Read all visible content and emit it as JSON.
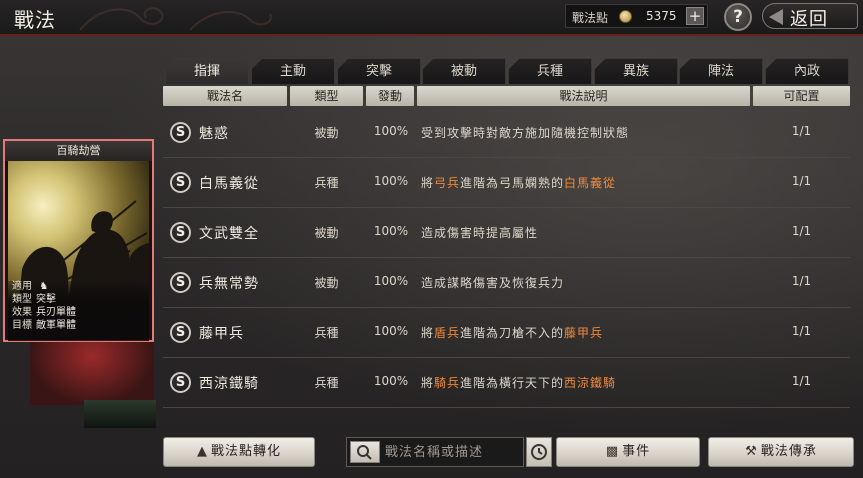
{
  "window": {
    "title": "戰法"
  },
  "header": {
    "points_label": "戰法點",
    "points_value": "5375",
    "plus_icon": "plus-icon",
    "help_label": "?",
    "back_label": "返回"
  },
  "tabs": [
    {
      "label": "指揮",
      "active": true
    },
    {
      "label": "主動"
    },
    {
      "label": "突擊"
    },
    {
      "label": "被動"
    },
    {
      "label": "兵種"
    },
    {
      "label": "異族"
    },
    {
      "label": "陣法"
    },
    {
      "label": "內政"
    }
  ],
  "columns": [
    "戰法名",
    "類型",
    "發動",
    "戰法說明",
    "可配置"
  ],
  "rows": [
    {
      "icon": "S",
      "name": "魅惑",
      "type": "被動",
      "rate": "100%",
      "desc": [
        {
          "t": "受到攻擊時對敵方施加隨機控制狀態"
        }
      ],
      "cfg": "1/1"
    },
    {
      "icon": "S",
      "name": "白馬義從",
      "type": "兵種",
      "rate": "100%",
      "desc": [
        {
          "t": "將"
        },
        {
          "t": "弓兵",
          "hl": true
        },
        {
          "t": "進階為弓馬嫻熟的"
        },
        {
          "t": "白馬義從",
          "hl": true
        }
      ],
      "cfg": "1/1"
    },
    {
      "icon": "S",
      "name": "文武雙全",
      "type": "被動",
      "rate": "100%",
      "desc": [
        {
          "t": "造成傷害時提高屬性"
        }
      ],
      "cfg": "1/1"
    },
    {
      "icon": "S",
      "name": "兵無常勢",
      "type": "被動",
      "rate": "100%",
      "desc": [
        {
          "t": "造成謀略傷害及恢復兵力"
        }
      ],
      "cfg": "1/1"
    },
    {
      "icon": "S",
      "name": "藤甲兵",
      "type": "兵種",
      "rate": "100%",
      "desc": [
        {
          "t": "將"
        },
        {
          "t": "盾兵",
          "hl": true
        },
        {
          "t": "進階為刀槍不入的"
        },
        {
          "t": "藤甲兵",
          "hl": true
        }
      ],
      "cfg": "1/1"
    },
    {
      "icon": "S",
      "name": "西涼鐵騎",
      "type": "兵種",
      "rate": "100%",
      "desc": [
        {
          "t": "將"
        },
        {
          "t": "騎兵",
          "hl": true
        },
        {
          "t": "進階為橫行天下的"
        },
        {
          "t": "西涼鐵騎",
          "hl": true
        }
      ],
      "cfg": "1/1"
    }
  ],
  "card": {
    "title": "百騎劫營",
    "fields": [
      {
        "key": "適用",
        "value": "",
        "icon": "cavalry-icon"
      },
      {
        "key": "類型",
        "value": "突擊"
      },
      {
        "key": "效果",
        "value": "兵刃單體"
      },
      {
        "key": "目標",
        "value": "敵軍單體"
      }
    ]
  },
  "footer": {
    "convert_label": "戰法點轉化",
    "search_placeholder": "戰法名稱或描述",
    "event_label": "事件",
    "inherit_label": "戰法傳承"
  },
  "colors": {
    "highlight": "#f08a3c",
    "card_border": "#e47a7a",
    "top_border": "#6a1f1a"
  }
}
